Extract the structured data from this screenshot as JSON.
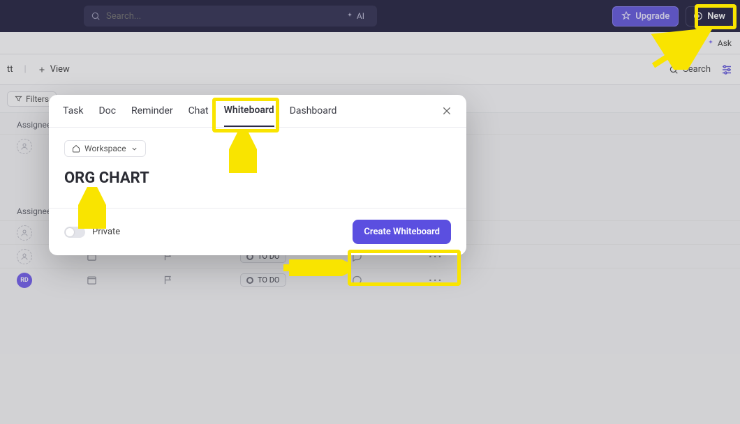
{
  "topbar": {
    "search_placeholder": "Search...",
    "ai_label": "AI",
    "upgrade_label": "Upgrade",
    "new_label": "New"
  },
  "subbar": {
    "ask_label": "Ask"
  },
  "viewbar": {
    "tt_label": "tt",
    "view_label": "View",
    "search_label": "Search"
  },
  "filterbar": {
    "filters_label": "Filters"
  },
  "groups": {
    "assignee_label": "Assignee"
  },
  "rows": {
    "status_label": "TO DO",
    "avatar_initials": "RD"
  },
  "modal": {
    "tabs": {
      "task": "Task",
      "doc": "Doc",
      "reminder": "Reminder",
      "chat": "Chat",
      "whiteboard": "Whiteboard",
      "dashboard": "Dashboard"
    },
    "location_label": "Workspace",
    "title_value": "ORG CHART",
    "private_label": "Private",
    "create_label": "Create Whiteboard"
  }
}
